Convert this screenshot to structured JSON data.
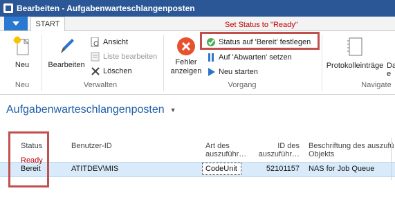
{
  "window": {
    "title": "Bearbeiten - Aufgabenwarteschlangenposten"
  },
  "ribbon": {
    "tab_start": "START",
    "neu_label": "Neu",
    "group_neu": "Neu",
    "bearbeiten_label": "Bearbeiten",
    "ansicht_label": "Ansicht",
    "liste_bearbeiten_label": "Liste bearbeiten",
    "loeschen_label": "Löschen",
    "group_verwalten": "Verwalten",
    "fehler_line1": "Fehler",
    "fehler_line2": "anzeigen",
    "status_bereit_label": "Status auf 'Bereit' festlegen",
    "abwarten_label": "Auf 'Abwarten' setzen",
    "neu_starten_label": "Neu starten",
    "group_vorgang": "Vorgang",
    "protokoll_label": "Protokolleinträge",
    "next_label_part": "Da",
    "next_label_part2": "e",
    "group_navigate": "Navigate"
  },
  "annotations": {
    "set_status": "Set Status to \"Ready\"",
    "ready": "Ready"
  },
  "page": {
    "title": "Aufgabenwarteschlangenposten"
  },
  "table": {
    "columns": {
      "status": "Status",
      "benutzer": "Benutzer-ID",
      "art_line1": "Art des",
      "art_line2": "auszuführ…",
      "id_line1": "ID des",
      "id_line2": "auszuführ…",
      "beschr_line1": "Beschriftung des auszufü",
      "beschr_line2": "Objekts"
    },
    "rows": [
      {
        "status": "Bereit",
        "benutzer": "ATITDEV\\MIS",
        "art": "CodeUnit",
        "id": "52101157",
        "beschr": "NAS for Job Queue"
      }
    ]
  }
}
